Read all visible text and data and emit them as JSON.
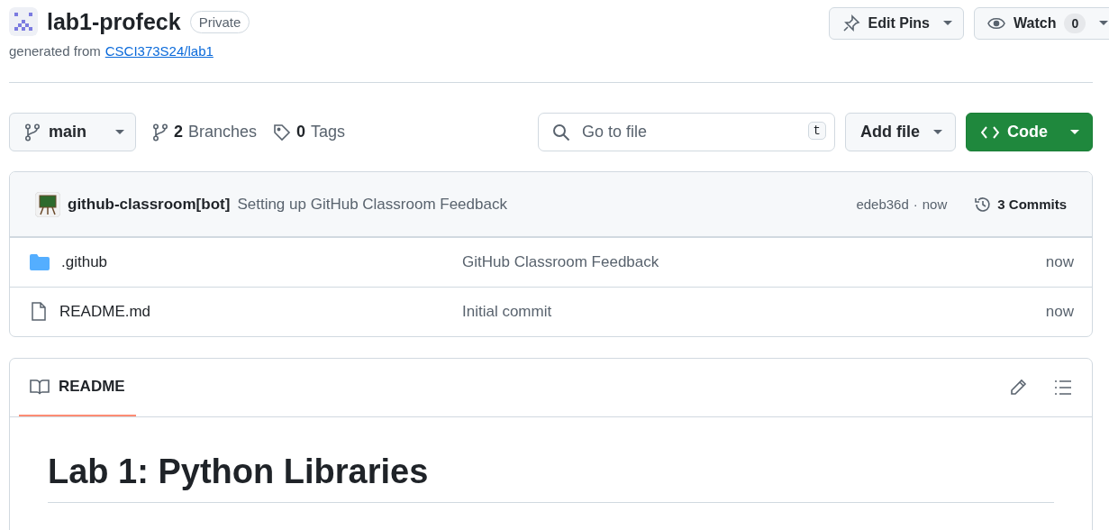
{
  "repo": {
    "name": "lab1-profeck",
    "visibility": "Private",
    "generated_prefix": "generated from",
    "template_link": "CSCI373S24/lab1"
  },
  "actions": [
    {
      "label": "Edit Pins",
      "kind": "pin"
    },
    {
      "label": "Watch",
      "kind": "watch",
      "count": "0"
    }
  ],
  "branch": {
    "name": "main"
  },
  "branches": {
    "count": "2",
    "label": "Branches"
  },
  "tags": {
    "count": "0",
    "label": "Tags"
  },
  "search": {
    "placeholder": "Go to file",
    "shortcut": "t"
  },
  "add_file": "Add file",
  "code_button": "Code",
  "commit": {
    "author": "github-classroom[bot]",
    "message": "Setting up GitHub Classroom Feedback",
    "hash": "edeb36d",
    "separator": "·",
    "time": "now",
    "commits": "3 Commits"
  },
  "files": [
    {
      "name": ".github",
      "kind": "folder",
      "message": "GitHub Classroom Feedback",
      "time": "now"
    },
    {
      "name": "README.md",
      "kind": "file",
      "message": "Initial commit",
      "time": "now"
    }
  ],
  "readme": {
    "tabs": [
      {
        "label": "README",
        "selected": true
      }
    ],
    "heading": "Lab 1: Python Libraries"
  }
}
